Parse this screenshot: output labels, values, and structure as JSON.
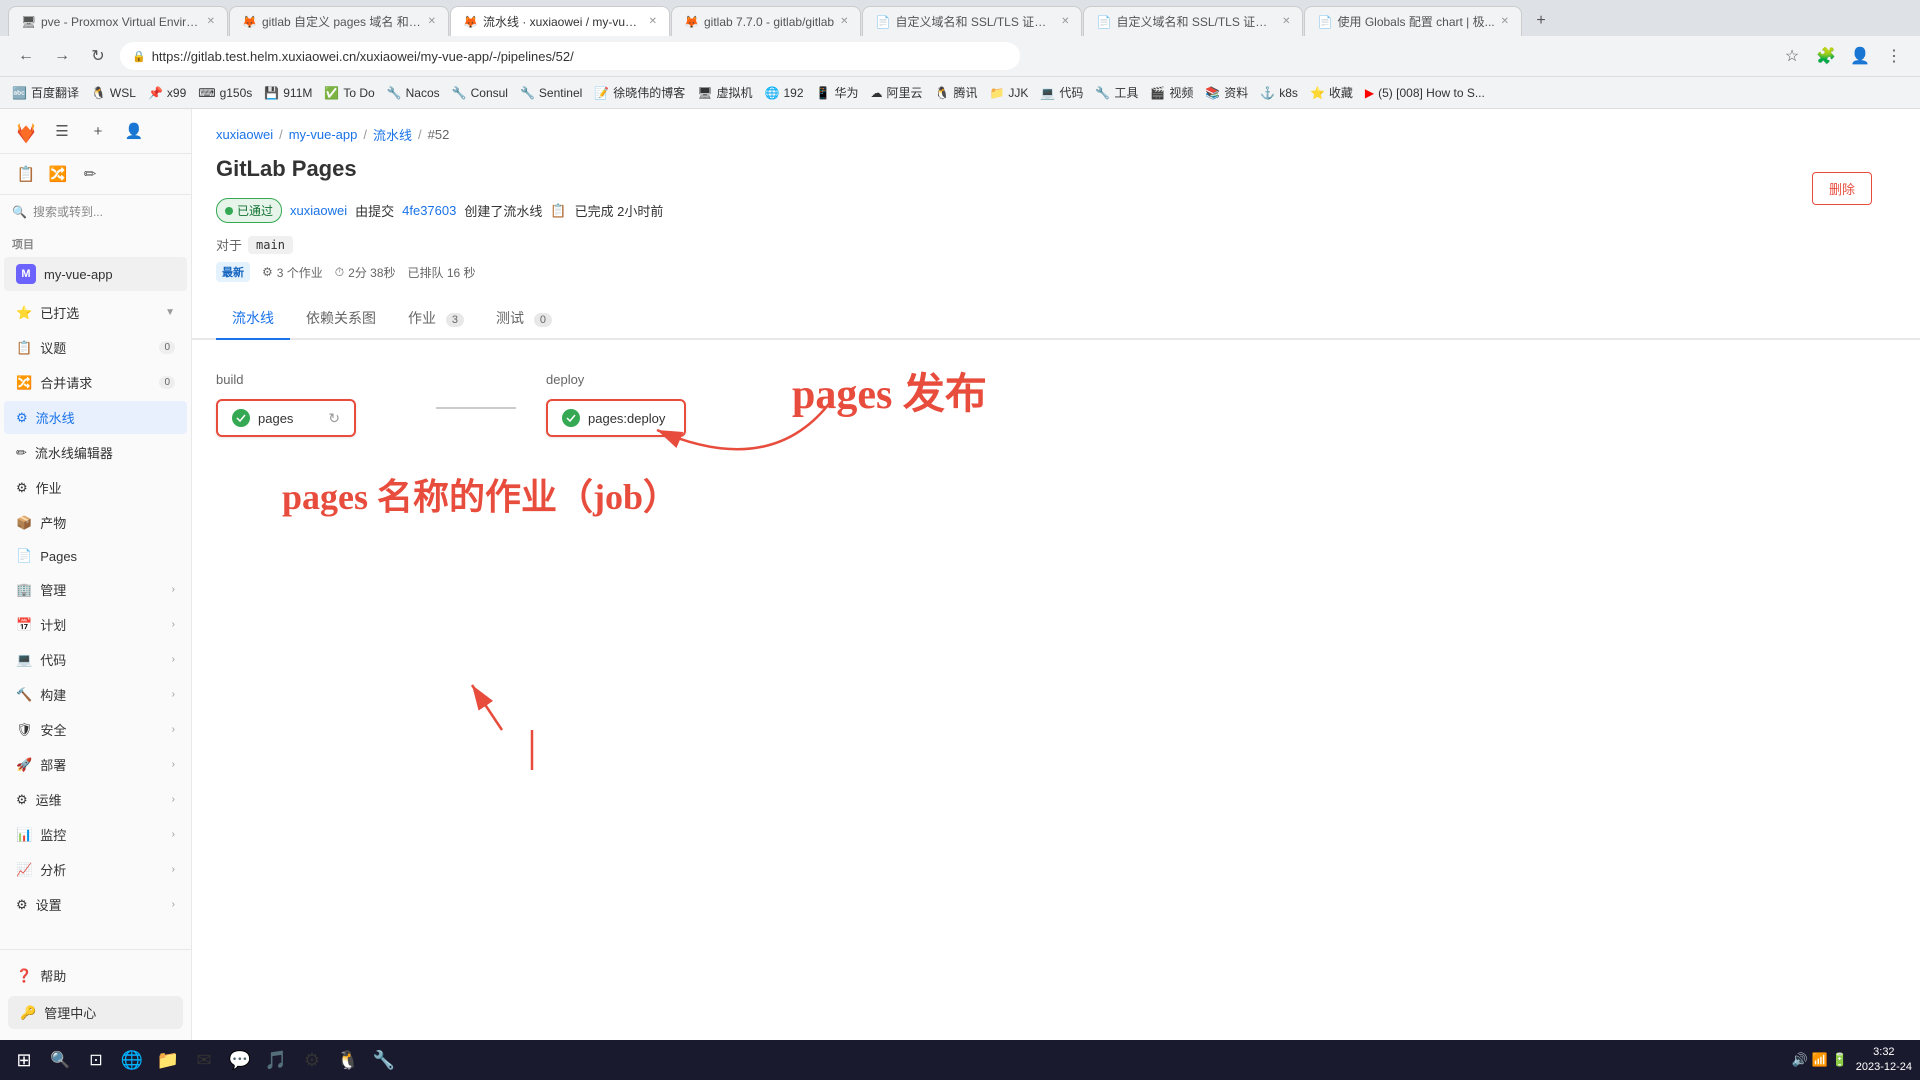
{
  "browser": {
    "tabs": [
      {
        "id": 1,
        "label": "pve - Proxmox Virtual Enviro...",
        "favicon": "🖥",
        "active": false
      },
      {
        "id": 2,
        "label": "gitlab 自定义 pages 域名 和 S...",
        "favicon": "🦊",
        "active": false
      },
      {
        "id": 3,
        "label": "流水线 · xuxiaowei / my-vue-...",
        "favicon": "🦊",
        "active": true
      },
      {
        "id": 4,
        "label": "gitlab 7.7.0 - gitlab/gitlab",
        "favicon": "🦊",
        "active": false
      },
      {
        "id": 5,
        "label": "自定义域名和 SSL/TLS 证书 | ...",
        "favicon": "📄",
        "active": false
      },
      {
        "id": 6,
        "label": "自定义域名和 SSL/TLS 证书 | ...",
        "favicon": "📄",
        "active": false
      },
      {
        "id": 7,
        "label": "使用 Globals 配置 chart | 极...",
        "favicon": "📄",
        "active": false
      }
    ],
    "address": "https://gitlab.test.helm.xuxiaowei.cn/xuxiaowei/my-vue-app/-/pipelines/52/",
    "bookmarks": [
      {
        "label": "百度翻译",
        "favicon": "🔤"
      },
      {
        "label": "WSL",
        "favicon": "🐧"
      },
      {
        "label": "x99",
        "favicon": "📌"
      },
      {
        "label": "g150s",
        "favicon": "⌨"
      },
      {
        "label": "911M",
        "favicon": "💾"
      },
      {
        "label": "To Do",
        "favicon": "✅"
      },
      {
        "label": "Nacos",
        "favicon": "🔧"
      },
      {
        "label": "Consul",
        "favicon": "🔧"
      },
      {
        "label": "Sentinel",
        "favicon": "🔧"
      },
      {
        "label": "徐晓伟的博客",
        "favicon": "📝"
      },
      {
        "label": "虚拟机",
        "favicon": "🖥"
      },
      {
        "label": "192",
        "favicon": "🌐"
      },
      {
        "label": "华为",
        "favicon": "📱"
      },
      {
        "label": "阿里云",
        "favicon": "☁"
      },
      {
        "label": "腾讯",
        "favicon": "🐧"
      },
      {
        "label": "JJK",
        "favicon": "📁"
      },
      {
        "label": "代码",
        "favicon": "💻"
      },
      {
        "label": "工具",
        "favicon": "🔧"
      },
      {
        "label": "视频",
        "favicon": "🎬"
      },
      {
        "label": "资料",
        "favicon": "📚"
      },
      {
        "label": "k8s",
        "favicon": "⚓"
      },
      {
        "label": "收藏",
        "favicon": "⭐"
      },
      {
        "label": "(5) [008] How to S...",
        "favicon": "▶"
      }
    ]
  },
  "sidebar": {
    "search_placeholder": "搜索或转到...",
    "project_label": "项目",
    "project_name": "my-vue-app",
    "project_namespace": "M",
    "starred_label": "已打选",
    "items": [
      {
        "label": "议题",
        "badge": "0",
        "hasChevron": false
      },
      {
        "label": "合并请求",
        "badge": "0",
        "hasChevron": false
      },
      {
        "label": "流水线",
        "badge": "",
        "hasChevron": false,
        "active": true
      },
      {
        "label": "流水线编辑器",
        "badge": "",
        "hasChevron": false
      },
      {
        "label": "作业",
        "badge": "",
        "hasChevron": false
      },
      {
        "label": "产物",
        "badge": "",
        "hasChevron": false
      },
      {
        "label": "Pages",
        "badge": "",
        "hasChevron": false
      },
      {
        "label": "管理",
        "badge": "",
        "hasChevron": true
      },
      {
        "label": "计划",
        "badge": "",
        "hasChevron": true
      },
      {
        "label": "代码",
        "badge": "",
        "hasChevron": true
      },
      {
        "label": "构建",
        "badge": "",
        "hasChevron": true
      },
      {
        "label": "安全",
        "badge": "",
        "hasChevron": true
      },
      {
        "label": "部署",
        "badge": "",
        "hasChevron": true
      },
      {
        "label": "运维",
        "badge": "",
        "hasChevron": true
      },
      {
        "label": "监控",
        "badge": "",
        "hasChevron": true
      },
      {
        "label": "分析",
        "badge": "",
        "hasChevron": true
      },
      {
        "label": "设置",
        "badge": "",
        "hasChevron": true
      }
    ],
    "bottom": {
      "help_label": "帮助",
      "admin_label": "管理中心"
    }
  },
  "main": {
    "breadcrumb": {
      "parts": [
        "xuxiaowei",
        "my-vue-app",
        "流水线",
        "#52"
      ]
    },
    "page_title": "GitLab Pages",
    "pipeline": {
      "status": "已通过",
      "author": "xuxiaowei",
      "commit": "4fe37603",
      "action": "创建了流水线",
      "time": "已完成 2小时前",
      "for_label": "对于",
      "branch": "main",
      "newest_label": "最新",
      "jobs_count": "3 个作业",
      "duration": "2分 38秒",
      "queue": "已排队 16 秒"
    },
    "tabs": [
      {
        "label": "流水线",
        "badge": null,
        "active": true
      },
      {
        "label": "依赖关系图",
        "badge": null
      },
      {
        "label": "作业",
        "badge": "3"
      },
      {
        "label": "测试",
        "badge": "0"
      }
    ],
    "stages": [
      {
        "name": "build",
        "jobs": [
          {
            "name": "pages",
            "status": "passed",
            "retry": true,
            "highlighted": true
          }
        ]
      },
      {
        "name": "deploy",
        "jobs": [
          {
            "name": "pages:deploy",
            "status": "passed",
            "retry": false,
            "highlighted": true
          }
        ]
      }
    ],
    "annotations": {
      "title": "pages 发布",
      "subtitle": "pages 名称的作业（job）"
    },
    "delete_btn": "删除"
  },
  "taskbar": {
    "time": "3:32",
    "date": "2023-12-24"
  }
}
